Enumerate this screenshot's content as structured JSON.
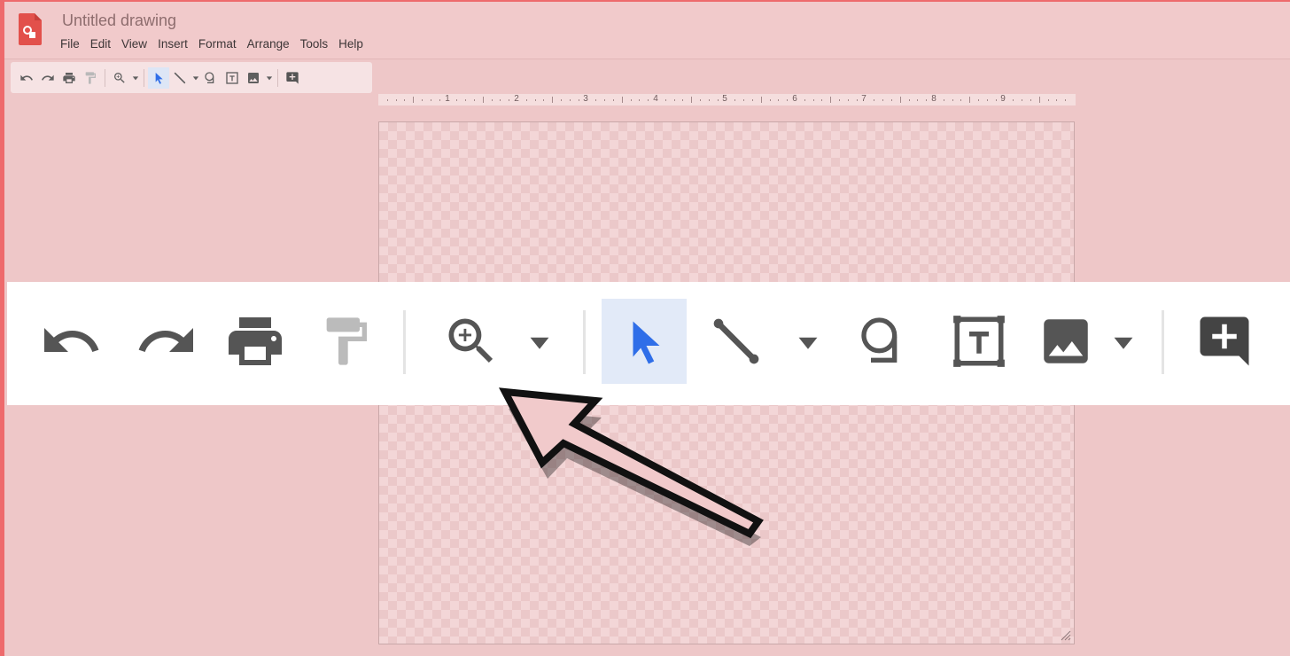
{
  "app": {
    "title": "Untitled drawing"
  },
  "menu": {
    "items": [
      "File",
      "Edit",
      "View",
      "Insert",
      "Format",
      "Arrange",
      "Tools",
      "Help"
    ]
  },
  "ruler": {
    "labels": [
      "1",
      "2",
      "3",
      "4",
      "5",
      "6",
      "7",
      "8",
      "9"
    ]
  },
  "toolbar": {
    "buttons": [
      "undo-icon",
      "redo-icon",
      "print-icon",
      "paint-format-icon",
      "zoom-icon",
      "select-cursor-icon",
      "line-icon",
      "shape-icon",
      "text-box-icon",
      "image-icon",
      "add-comment-icon"
    ],
    "active": "select-cursor-icon"
  },
  "colors": {
    "overlay": "#eec7c8",
    "frame_accent": "#ee6a6c",
    "select_active_bg": "#e2eaf8",
    "cursor_blue": "#2f6ee8",
    "icon_dark": "#555555",
    "icon_disabled": "#bbbbbb",
    "callout_arrow_fill": "#f1cacb",
    "callout_arrow_outline": "#111111",
    "logo_red": "#e2504b"
  }
}
